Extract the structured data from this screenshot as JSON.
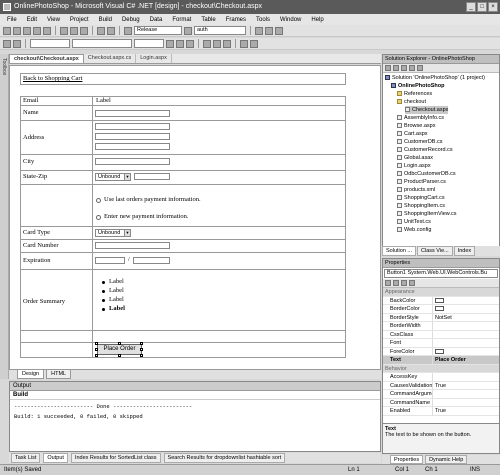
{
  "window": {
    "title": "OnlinePhotoShop - Microsoft Visual C# .NET [design] - checkout\\Checkout.aspx"
  },
  "menu": [
    "File",
    "Edit",
    "View",
    "Project",
    "Build",
    "Debug",
    "Data",
    "Format",
    "Table",
    "Frames",
    "Tools",
    "Window",
    "Help"
  ],
  "toolbar": {
    "config": "Release",
    "find": "auth"
  },
  "doc_tabs": [
    "checkout\\Checkout.aspx",
    "Checkout.aspx.cs",
    "Login.aspx"
  ],
  "left_strip": "Toolbox",
  "form": {
    "back_link": "Back to Shopping Cart",
    "email_label": "Email",
    "email_value": "Label",
    "name_label": "Name",
    "address_label": "Address",
    "city_label": "City",
    "state_zip_label": "State-Zip",
    "state_select": "Unbound",
    "radio_last": "Use last orders payment information.",
    "radio_new": "Enter new payment information.",
    "card_type_label": "Card Type",
    "card_type_select": "Unbound",
    "card_number_label": "Card Number",
    "expiration_label": "Expiration",
    "expiration_sep": "/",
    "order_summary_label": "Order Summary",
    "summary_items": [
      "Label",
      "Label",
      "Label",
      "Label"
    ],
    "place_order": "Place Order"
  },
  "view_tabs": [
    "Design",
    "HTML"
  ],
  "output": {
    "title": "Output",
    "pane": "Build",
    "line1": "------------------------ Done ------------------------",
    "line2": "Build: 1 succeeded, 0 failed, 0 skipped"
  },
  "bottom_tabs": [
    "Task List",
    "Output",
    "Index Results for SortedList class",
    "Search Results for dropdownlist hashtable sort"
  ],
  "status": {
    "text": "Item(s) Saved",
    "ln": "Ln 1",
    "col": "Col 1",
    "ch": "Ch 1",
    "mode": "INS"
  },
  "solution_explorer": {
    "title": "Solution Explorer - OnlinePhotoShop",
    "items": [
      "Solution 'OnlinePhotoShop' (1 project)",
      "OnlinePhotoShop",
      "References",
      "checkout",
      "Checkout.aspx",
      "AssemblyInfo.cs",
      "Browse.aspx",
      "Cart.aspx",
      "CustomerDB.cs",
      "CustomerRecord.cs",
      "Global.asax",
      "Login.aspx",
      "OdbcCustomerDB.cs",
      "ProductParser.cs",
      "products.xml",
      "ShoppingCart.cs",
      "ShoppingItem.cs",
      "ShoppingItemView.cs",
      "UnitTest.cs",
      "Web.config"
    ],
    "tabs": [
      "Solution ...",
      "Class Vie...",
      "Index"
    ]
  },
  "properties": {
    "title": "Properties",
    "object": "Button1  System.Web.UI.WebControls.Bu",
    "cat_appearance": "Appearance",
    "rows_appearance": [
      {
        "name": "BackColor",
        "value": ""
      },
      {
        "name": "BorderColor",
        "value": ""
      },
      {
        "name": "BorderStyle",
        "value": "NotSet"
      },
      {
        "name": "BorderWidth",
        "value": ""
      },
      {
        "name": "CssClass",
        "value": ""
      },
      {
        "name": "Font",
        "value": ""
      },
      {
        "name": "ForeColor",
        "value": ""
      },
      {
        "name": "Text",
        "value": "Place Order"
      }
    ],
    "cat_behavior": "Behavior",
    "rows_behavior": [
      {
        "name": "AccessKey",
        "value": ""
      },
      {
        "name": "CausesValidation",
        "value": "True"
      },
      {
        "name": "CommandArgument",
        "value": ""
      },
      {
        "name": "CommandName",
        "value": ""
      },
      {
        "name": "Enabled",
        "value": "True"
      }
    ],
    "desc_title": "Text",
    "desc_body": "The text to be shown on the button.",
    "tabs": [
      "Properties",
      "Dynamic Help"
    ]
  }
}
